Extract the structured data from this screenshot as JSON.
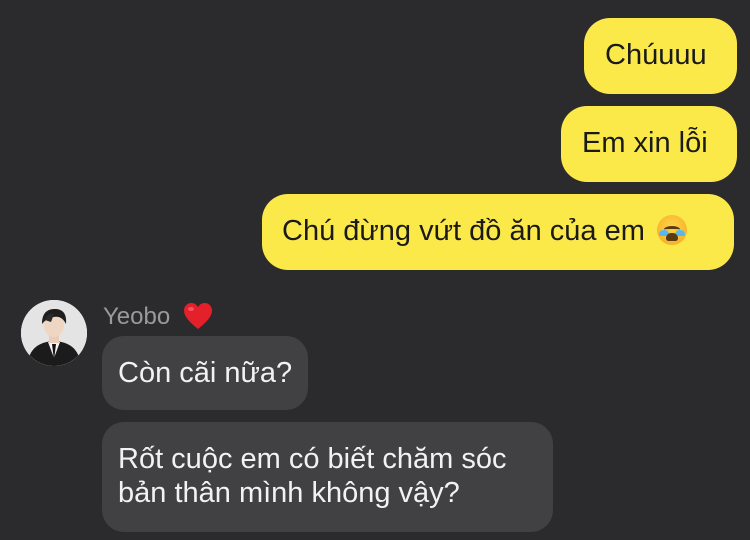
{
  "outgoing": [
    {
      "text": "Chúuuu"
    },
    {
      "text": "Em xin lỗi"
    },
    {
      "text": "Chú đừng vứt đồ ăn của em",
      "emoji": "loudly-crying-face-emoji"
    }
  ],
  "contact": {
    "name": "Yeobo",
    "name_emoji": "red-heart-emoji",
    "avatar": "profile-photo"
  },
  "incoming": [
    {
      "text": "Còn cãi nữa?"
    },
    {
      "lines": [
        "Rốt cuộc em có biết chăm sóc",
        "bản thân mình không vậy?"
      ]
    }
  ],
  "colors": {
    "background": "#2b2b2d",
    "outgoing_bubble": "#fbe94a",
    "incoming_bubble": "#414143",
    "sender_name": "#9a9a9c"
  }
}
